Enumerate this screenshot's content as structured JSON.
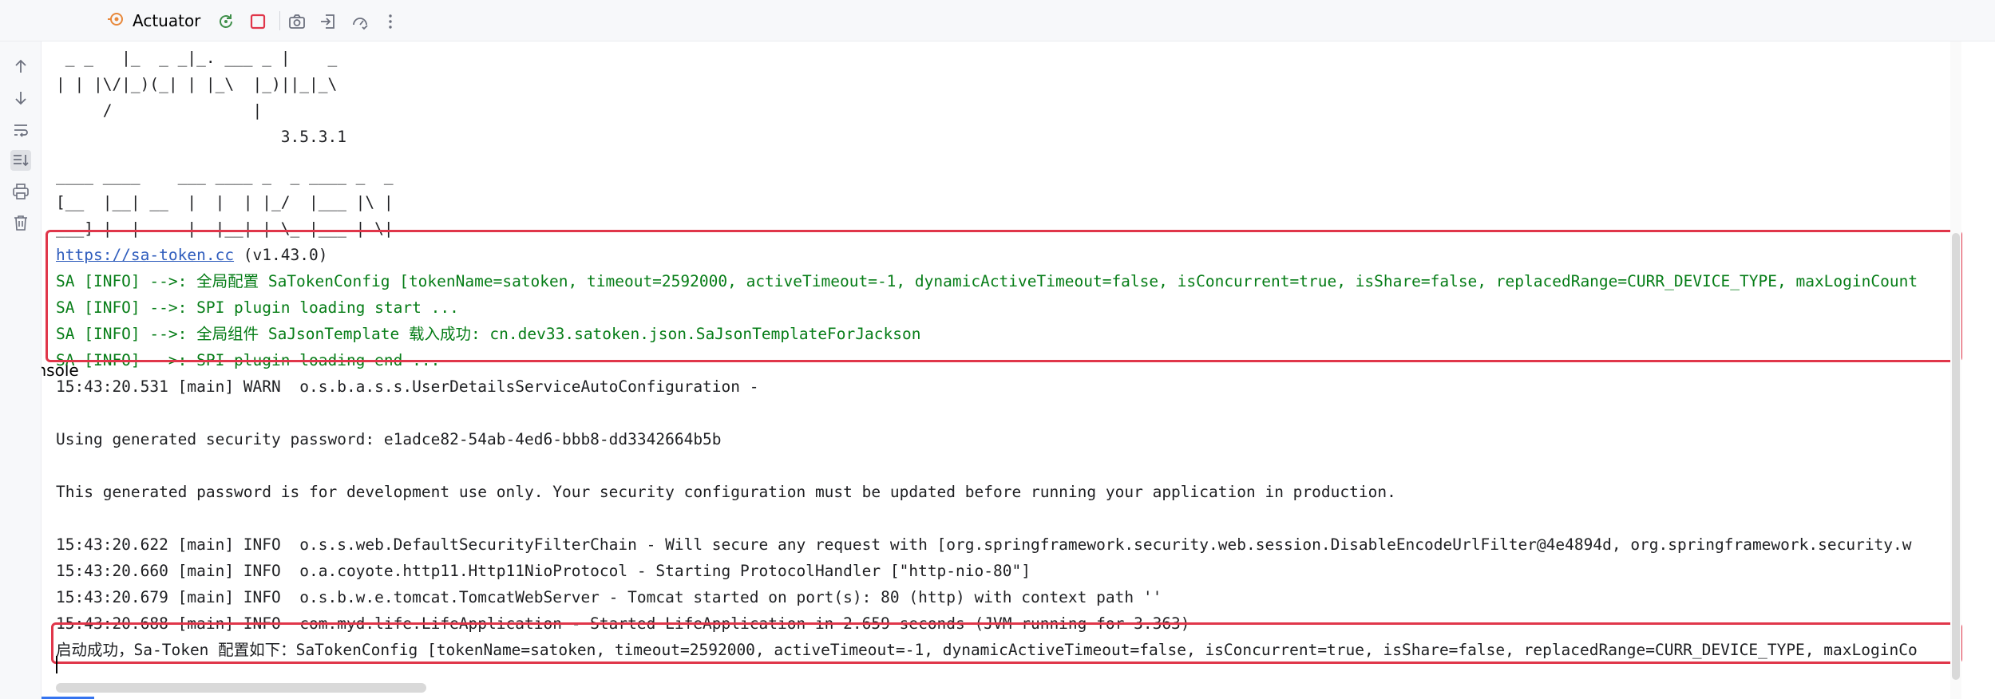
{
  "tabs": {
    "console": "Console",
    "actuator": "Actuator"
  },
  "toolbar_icons": [
    "rerun-icon",
    "stop-icon",
    "screenshot-icon",
    "exit-icon",
    "performance-icon",
    "more-icon"
  ],
  "gutter_icons": [
    "arrow-up-icon",
    "arrow-down-icon",
    "soft-wrap-icon",
    "scroll-to-end-icon",
    "print-icon",
    "trash-icon"
  ],
  "console": {
    "banner_mybatis": [
      " _ _   |_  _ _|_. ___ _ |    _",
      "| | |\\/|_)(_| | |_\\  |_)||_|_\\",
      "     /               |",
      "                        3.5.3.1"
    ],
    "banner_satoken": [
      "____ ____    ___ ____ _  _ ____ _  _",
      "[__  |__| __  |  |  | |_/  |___ |\\ |",
      "___] |  |     |  |__| | \\_ |___ | \\|"
    ],
    "satoken_url": "https://sa-token.cc",
    "satoken_version": " (v1.43.0)",
    "satoken_logs": [
      "SA [INFO] -->: 全局配置 SaTokenConfig [tokenName=satoken, timeout=2592000, activeTimeout=-1, dynamicActiveTimeout=false, isConcurrent=true, isShare=false, replacedRange=CURR_DEVICE_TYPE, maxLoginCount",
      "SA [INFO] -->: SPI plugin loading start ...",
      "SA [INFO] -->: 全局组件 SaJsonTemplate 载入成功: cn.dev33.satoken.json.SaJsonTemplateForJackson",
      "SA [INFO] -->: SPI plugin loading end ..."
    ],
    "warn_line": "15:43:20.531 [main] WARN  o.s.b.a.s.s.UserDetailsServiceAutoConfiguration -",
    "password_line": "Using generated security password: e1adce82-54ab-4ed6-bbb8-dd3342664b5b",
    "dev_note": "This generated password is for development use only. Your security configuration must be updated before running your application in production.",
    "info_logs": [
      "15:43:20.622 [main] INFO  o.s.s.web.DefaultSecurityFilterChain - Will secure any request with [org.springframework.security.web.session.DisableEncodeUrlFilter@4e4894d, org.springframework.security.w",
      "15:43:20.660 [main] INFO  o.a.coyote.http11.Http11NioProtocol - Starting ProtocolHandler [\"http-nio-80\"]",
      "15:43:20.679 [main] INFO  o.s.b.w.e.tomcat.TomcatWebServer - Tomcat started on port(s): 80 (http) with context path ''",
      "15:43:20.688 [main] INFO  com.myd.life.LifeApplication - Started LifeApplication in 2.659 seconds (JVM running for 3.363)"
    ],
    "startup_line": "启动成功，Sa-Token 配置如下：SaTokenConfig [tokenName=satoken, timeout=2592000, activeTimeout=-1, dynamicActiveTimeout=false, isConcurrent=true, isShare=false, replacedRange=CURR_DEVICE_TYPE, maxLoginCo"
  },
  "colors": {
    "highlight": "#e0364a",
    "log_green": "#067d17",
    "link_blue": "#2f5dbd",
    "tab_underline": "#3574f0"
  }
}
